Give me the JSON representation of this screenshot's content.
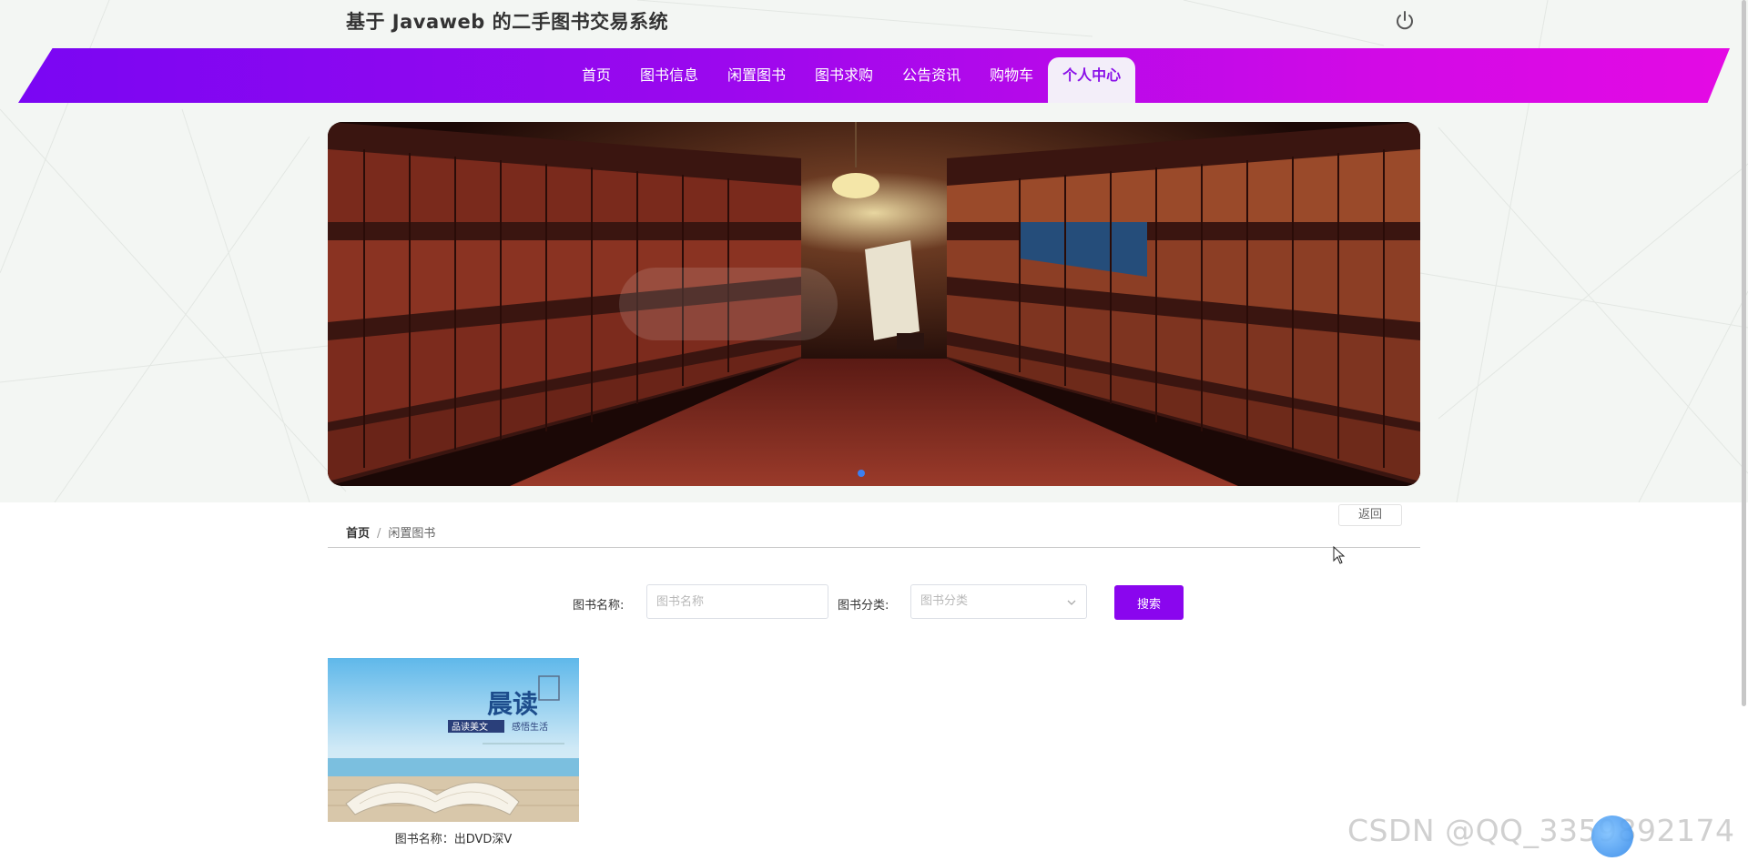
{
  "header": {
    "site_title": "基于 Javaweb 的二手图书交易系统",
    "power_icon": "power-icon"
  },
  "nav": {
    "items": [
      {
        "label": "首页",
        "active": false
      },
      {
        "label": "图书信息",
        "active": false
      },
      {
        "label": "闲置图书",
        "active": false
      },
      {
        "label": "图书求购",
        "active": false
      },
      {
        "label": "公告资讯",
        "active": false
      },
      {
        "label": "购物车",
        "active": false
      },
      {
        "label": "个人中心",
        "active": true
      }
    ]
  },
  "breadcrumb": {
    "home": "首页",
    "separator": "/",
    "current": "闲置图书"
  },
  "back_button": "返回",
  "search": {
    "name_label": "图书名称:",
    "name_placeholder": "图书名称",
    "name_value": "",
    "category_label": "图书分类:",
    "category_placeholder": "图书分类",
    "search_button": "搜索"
  },
  "books": [
    {
      "name": "图书名称：出DVD深V",
      "cover_title": "晨读",
      "cover_tag1": "品读美文",
      "cover_tag2": "感悟生活"
    }
  ],
  "watermark": "CSDN @QQ_3359892174",
  "colors": {
    "nav_gradient_start": "#7a06f3",
    "nav_gradient_end": "#e40ae4",
    "accent": "#8a06ee",
    "carousel_dot": "#3b7ff0"
  }
}
